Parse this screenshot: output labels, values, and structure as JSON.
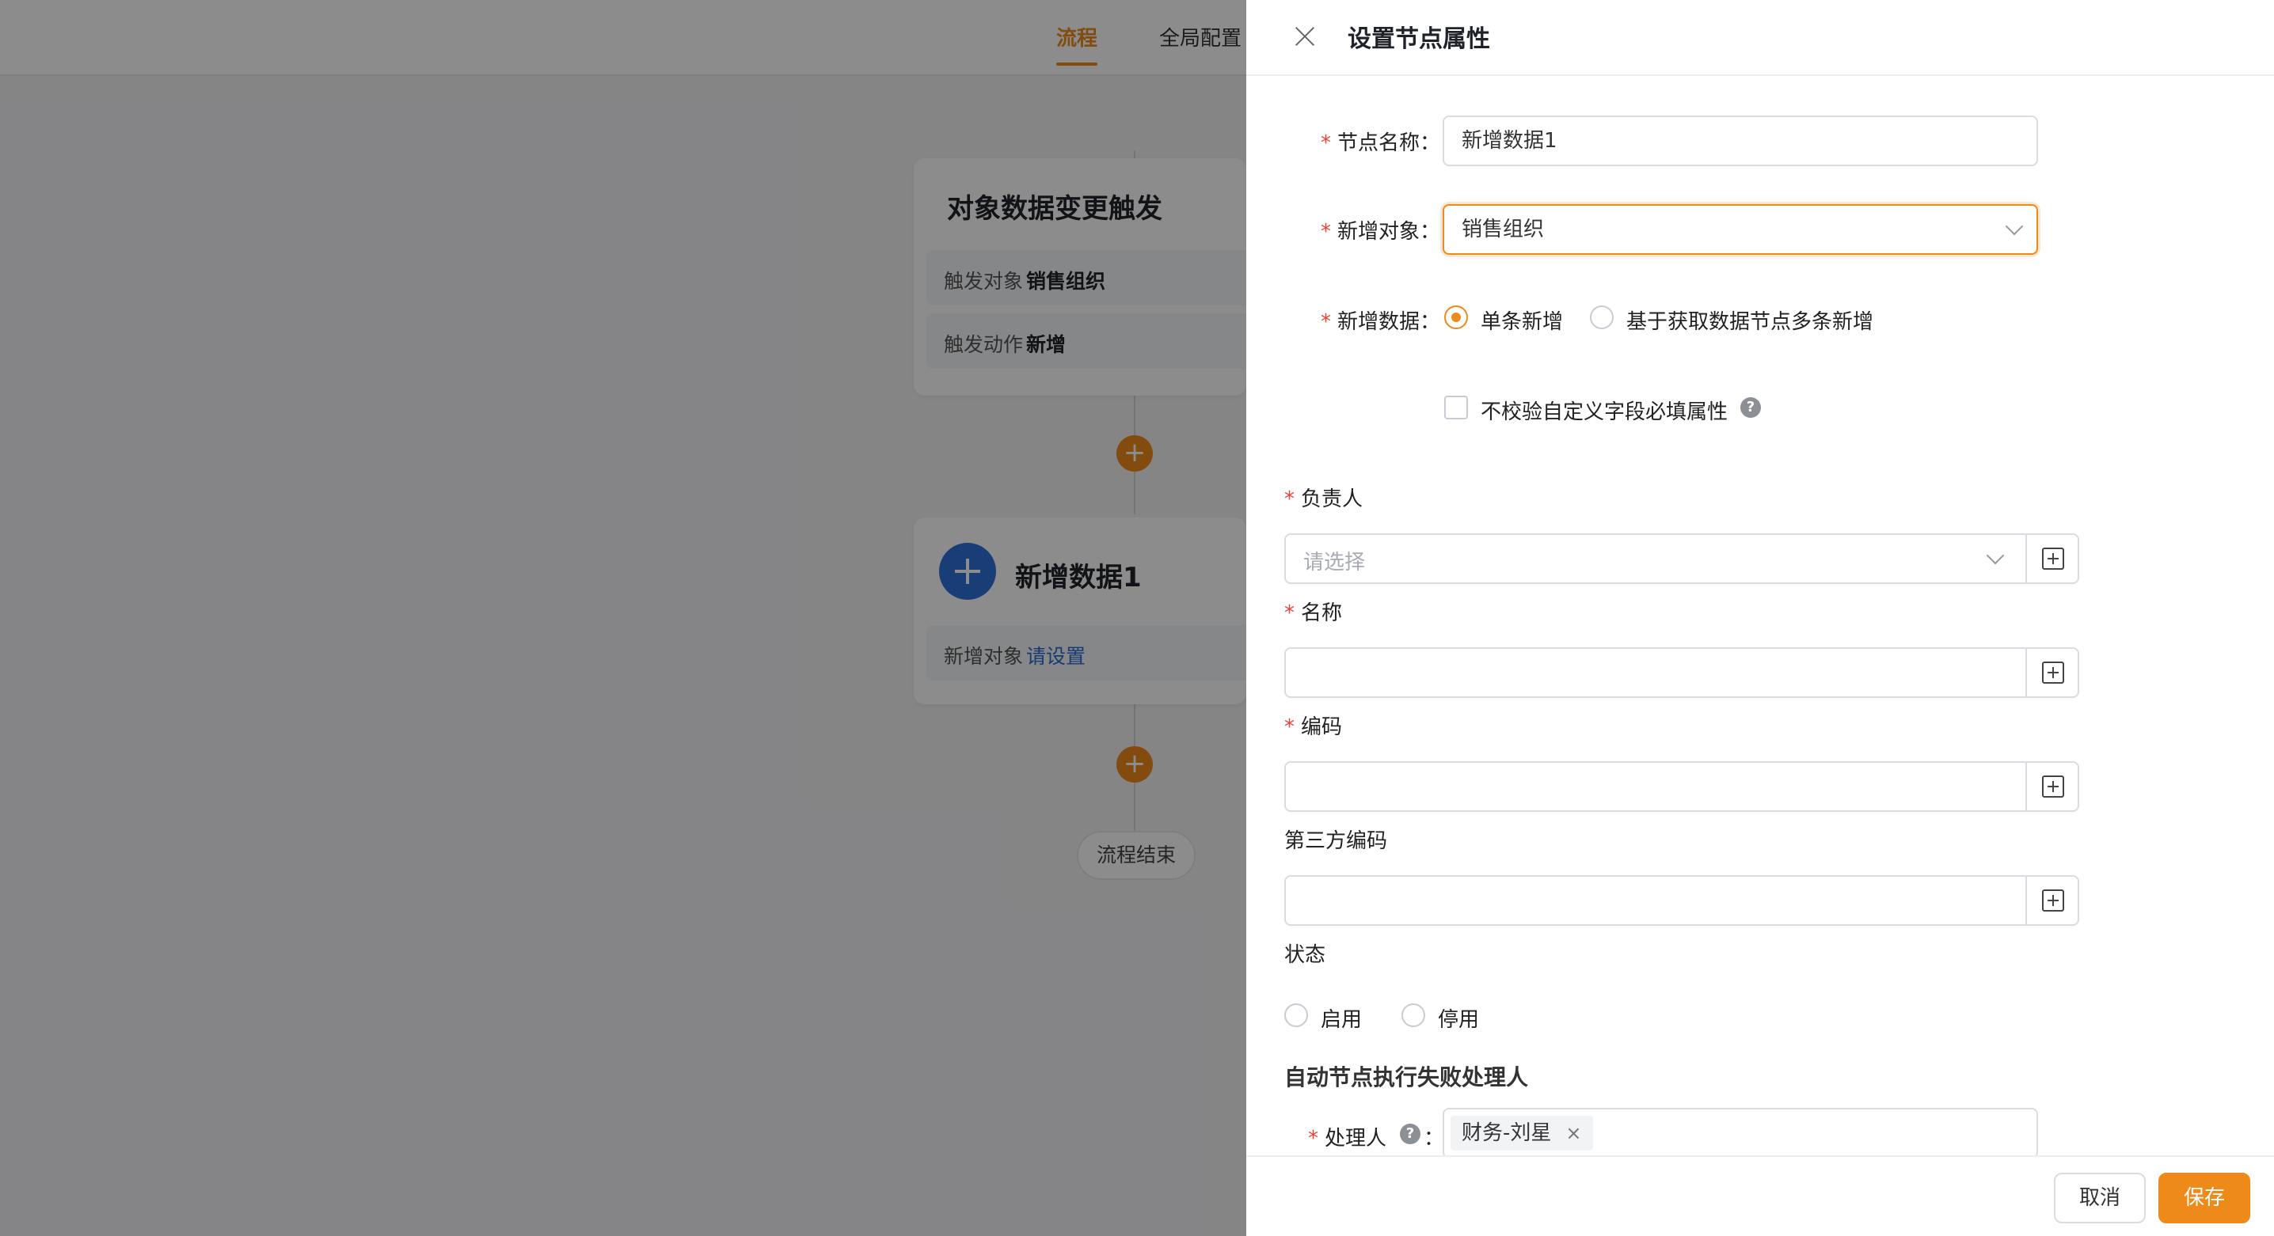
{
  "top_tabs": [
    "流程",
    "全局配置"
  ],
  "flow": {
    "trigger_card": {
      "title": "对象数据变更触发",
      "rows": [
        {
          "key": "触发对象",
          "value": "销售组织"
        },
        {
          "key": "触发动作",
          "value": "新增"
        }
      ]
    },
    "add_node_card": {
      "title": "新增数据1",
      "row": {
        "key": "新增对象",
        "value": "请设置"
      }
    },
    "end_label": "流程结束",
    "add_symbol": "+"
  },
  "drawer": {
    "title": "设置节点属性",
    "node_name": {
      "label": "节点名称",
      "value": "新增数据1"
    },
    "add_object": {
      "label": "新增对象",
      "value": "销售组织"
    },
    "add_data": {
      "label": "新增数据",
      "options": [
        "单条新增",
        "基于获取数据节点多条新增"
      ],
      "selected": 0
    },
    "skip_validation": {
      "label": "不校验自定义字段必填属性",
      "checked": false
    },
    "fields": [
      {
        "label": "负责人",
        "required": true,
        "placeholder": "请选择",
        "value": ""
      },
      {
        "label": "名称",
        "required": true,
        "value": ""
      },
      {
        "label": "编码",
        "required": true,
        "value": ""
      },
      {
        "label": "第三方编码",
        "required": false,
        "value": ""
      }
    ],
    "status": {
      "label": "状态",
      "options": [
        "启用",
        "停用"
      ],
      "selected": null
    },
    "fail_handler_section": "自动节点执行失败处理人",
    "handler": {
      "label": "处理人",
      "tags": [
        "财务-刘星"
      ]
    },
    "buttons": {
      "cancel": "取消",
      "save": "保存"
    }
  },
  "colors": {
    "accent": "#ee8a1a",
    "required": "#f04134",
    "link": "#2b6bd6",
    "node_icon": "#2e6fd7"
  }
}
